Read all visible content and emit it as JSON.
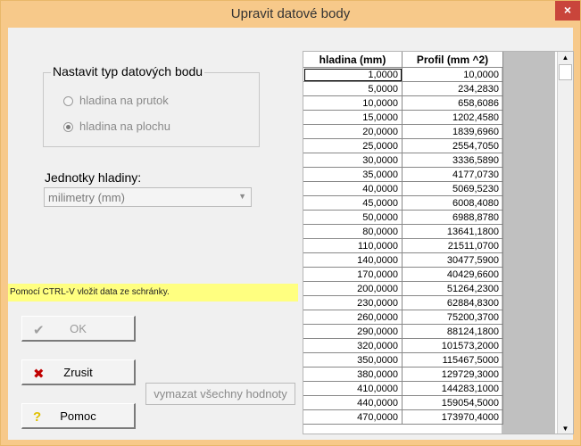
{
  "window": {
    "title": "Upravit datové body",
    "close_glyph": "×"
  },
  "datatype": {
    "legend": "Nastavit typ datových bodu",
    "options": [
      {
        "label": "hladina na prutok",
        "selected": false
      },
      {
        "label": "hladina na plochu",
        "selected": true
      }
    ]
  },
  "units": {
    "label": "Jednotky hladiny:",
    "value": "milimetry (mm)",
    "arrow_glyph": "▼"
  },
  "hint": "Pomocí CTRL-V vložit data ze schránky.",
  "buttons": {
    "ok": {
      "label": "OK",
      "icon": "check-icon",
      "glyph": "✔"
    },
    "cancel": {
      "label": "Zrusit",
      "icon": "x-mark-icon",
      "glyph": "✖"
    },
    "help": {
      "label": "Pomoc",
      "icon": "question-mark-icon",
      "glyph": "?"
    },
    "clear_all": "vymazat všechny hodnoty"
  },
  "table": {
    "headers": [
      "hladina (mm)",
      "Profil (mm ^2)"
    ],
    "rows": [
      [
        "1,0000",
        "10,0000"
      ],
      [
        "5,0000",
        "234,2830"
      ],
      [
        "10,0000",
        "658,6086"
      ],
      [
        "15,0000",
        "1202,4580"
      ],
      [
        "20,0000",
        "1839,6960"
      ],
      [
        "25,0000",
        "2554,7050"
      ],
      [
        "30,0000",
        "3336,5890"
      ],
      [
        "35,0000",
        "4177,0730"
      ],
      [
        "40,0000",
        "5069,5230"
      ],
      [
        "45,0000",
        "6008,4080"
      ],
      [
        "50,0000",
        "6988,8780"
      ],
      [
        "80,0000",
        "13641,1800"
      ],
      [
        "110,0000",
        "21511,0700"
      ],
      [
        "140,0000",
        "30477,5900"
      ],
      [
        "170,0000",
        "40429,6600"
      ],
      [
        "200,0000",
        "51264,2300"
      ],
      [
        "230,0000",
        "62884,8300"
      ],
      [
        "260,0000",
        "75200,3700"
      ],
      [
        "290,0000",
        "88124,1800"
      ],
      [
        "320,0000",
        "101573,2000"
      ],
      [
        "350,0000",
        "115467,5000"
      ],
      [
        "380,0000",
        "129729,3000"
      ],
      [
        "410,0000",
        "144283,1000"
      ],
      [
        "440,0000",
        "159054,5000"
      ],
      [
        "470,0000",
        "173970,4000"
      ]
    ],
    "scroll_up_glyph": "▲",
    "scroll_down_glyph": "▼"
  },
  "colors": {
    "title_bar": "#f7c98a",
    "close_button": "#c9453b",
    "hint_background": "#ffff80",
    "cancel_icon": "#c00000",
    "help_icon": "#e0c000",
    "ok_icon": "#a0a0a0"
  }
}
